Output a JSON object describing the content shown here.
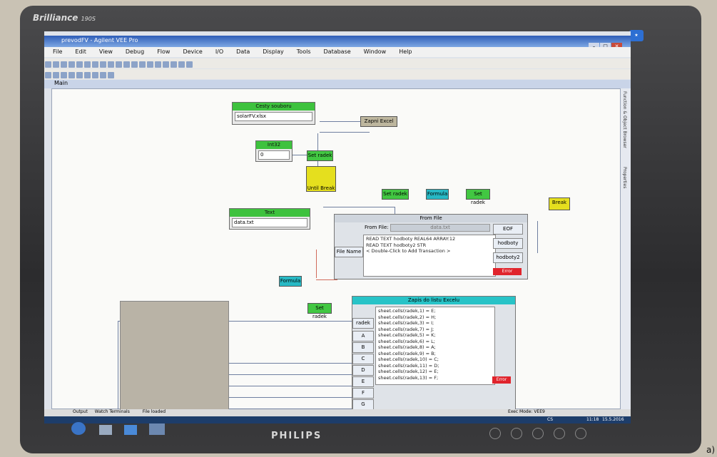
{
  "monitor": {
    "brand": "Brilliance",
    "model": "190S",
    "maker": "PHILIPS"
  },
  "window": {
    "title": "prevodFV - Agilent VEE Pro"
  },
  "menu": [
    "File",
    "Edit",
    "View",
    "Debug",
    "Flow",
    "Device",
    "I/O",
    "Data",
    "Display",
    "Tools",
    "Database",
    "Window",
    "Help"
  ],
  "main_tab": "Main",
  "side_tabs": [
    "Function & Object Browser",
    "Properties"
  ],
  "nodes": {
    "cesta": {
      "title": "Cesty souboru",
      "value": "solarFV.xlsx"
    },
    "int": {
      "title": "Int32",
      "value": "0"
    },
    "text": {
      "title": "Text",
      "value": "data.txt"
    },
    "zapni": "Zapni Excel",
    "set_radek": "Set radek",
    "until": "Until Break",
    "formula": "Formula",
    "break": "Break"
  },
  "from_file": {
    "title": "From File",
    "label": "From File:",
    "file": "data.txt",
    "lines": [
      "READ TEXT hodboty REAL64 ARRAY:12",
      "READ TEXT hodboty2 STR",
      "< Double-Click to Add Transaction >"
    ],
    "input": "File Name",
    "outputs": [
      "EOF",
      "hodboty",
      "hodboty2"
    ],
    "error": "Error"
  },
  "zapis": {
    "title": "Zapis do listu Excelu",
    "inputs": [
      "radek",
      "A",
      "B",
      "C",
      "D",
      "E",
      "F",
      "G"
    ],
    "lines": [
      "sheet.cells(radek,1) = E;",
      "sheet.cells(radek,2) = H;",
      "sheet.cells(radek,3) = I;",
      "sheet.cells(radek,7) = J;",
      "sheet.cells(radek,5) = K;",
      "sheet.cells(radek,6) = L;",
      "sheet.cells(radek,8) = A;",
      "sheet.cells(radek,9) = B;",
      "sheet.cells(radek,10) = C;",
      "sheet.cells(radek,11) = D;",
      "sheet.cells(radek,12) = E;",
      "sheet.cells(radek,13) = F;"
    ],
    "error": "Error"
  },
  "status": {
    "left": "File loaded",
    "right": "Exec Mode: VEE9",
    "tabs": [
      "Output",
      "Watch Terminals"
    ]
  },
  "tray": {
    "lang": "CS",
    "time": "11:18",
    "date": "15.5.2016"
  },
  "outside_label": "a)"
}
